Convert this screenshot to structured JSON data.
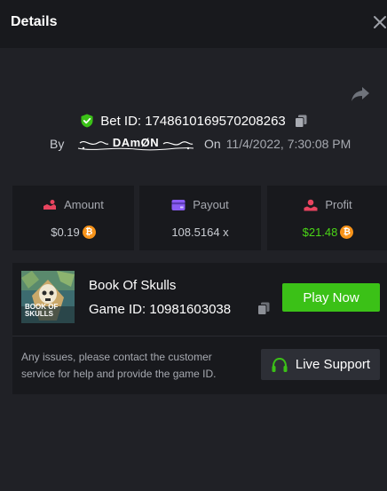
{
  "header": {
    "title": "Details",
    "close_icon": "close-icon"
  },
  "bet": {
    "id_label": "Bet ID: 1748610169570208263",
    "by_label": "By",
    "username": "DAmØN",
    "on_label": "On",
    "date": "11/4/2022, 7:30:08 PM",
    "icons": [
      "share-icon",
      "shield-check-icon",
      "copy-icon"
    ]
  },
  "stats": {
    "amount": {
      "label": "Amount",
      "value": "$0.19",
      "icon": "amount-icon",
      "coin": "bitcoin-icon"
    },
    "payout": {
      "label": "Payout",
      "value": "108.5164 x",
      "icon": "wallet-icon"
    },
    "profit": {
      "label": "Profit",
      "value": "$21.48",
      "icon": "profit-icon",
      "coin": "bitcoin-icon"
    }
  },
  "game": {
    "name": "Book Of Skulls",
    "id_label": "Game ID: 10981603038",
    "thumb_line1": "BOOK OF",
    "thumb_line2": "SKULLS",
    "play_label": "Play Now",
    "help_text": "Any issues, please contact the customer service for help and provide the game ID.",
    "support_label": "Live Support",
    "support_icon": "headset-icon"
  },
  "colors": {
    "background": "#202126",
    "panel": "#18191d",
    "accent_green": "#3bc117",
    "profit_green": "#4ad616",
    "bitcoin": "#f7931a",
    "amount_icon": "#e8445f",
    "payout_icon": "#8a5cf5",
    "profit_icon": "#e8445f"
  }
}
